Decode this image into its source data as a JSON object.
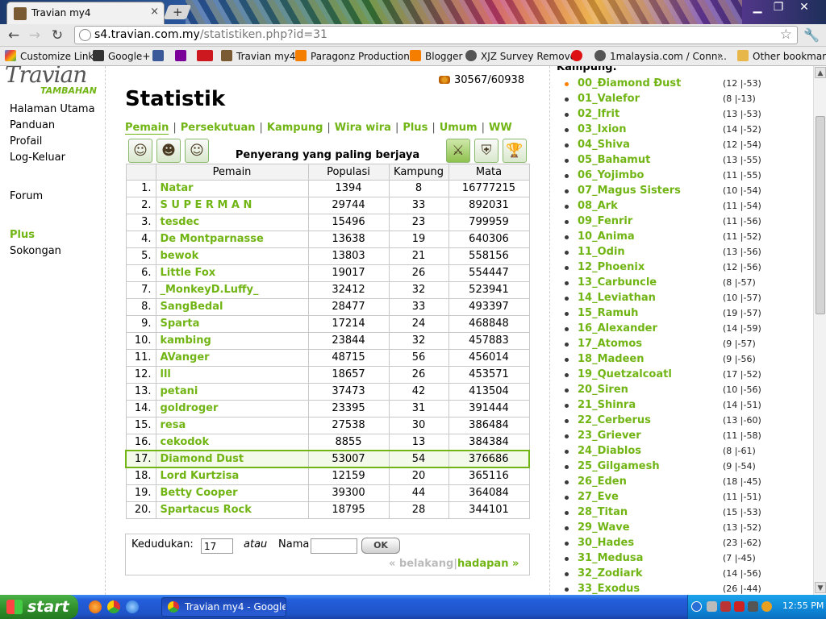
{
  "browser": {
    "tab_title": "Travian my4",
    "url_host": "s4.travian.com.my",
    "url_path": "/statistiken.php?id=31",
    "bookmarks": [
      "Customize Links",
      "Google+",
      "",
      "",
      "",
      "Travian my4",
      "Paragonz Production™",
      "Blogger",
      "XJZ Survey Remover",
      "",
      "1malaysia.com / Conn...",
      "Other bookmarks"
    ],
    "bookmarks_more": "»",
    "new_tab": "+",
    "close": "×"
  },
  "colors": {
    "accent": "#71b515",
    "active_village": "#ff8000"
  },
  "logo": {
    "main": "Travian",
    "sub": "TAMBAHAN"
  },
  "menu": [
    {
      "label": "Halaman Utama"
    },
    {
      "label": "Panduan"
    },
    {
      "label": "Profail"
    },
    {
      "label": "Log-Keluar"
    },
    {
      "label": "Forum"
    },
    {
      "label": "Plus"
    },
    {
      "label": "Sokongan"
    }
  ],
  "resources": {
    "crop": "30567/60938",
    "icon": "crop-icon"
  },
  "page_title": "Statistik",
  "stat_nav": [
    "Pemain",
    "Persekutuan",
    "Kampung",
    "Wira wira",
    "Plus",
    "Umum",
    "WW"
  ],
  "table": {
    "caption": "Penyerang yang paling berjaya",
    "headers": [
      "Pemain",
      "Populasi",
      "Kampung",
      "Mata"
    ],
    "highlight_rank": "17.",
    "rows": [
      {
        "rank": "1.",
        "name": "Natar",
        "pop": "1394",
        "vil": "8",
        "pts": "16777215"
      },
      {
        "rank": "2.",
        "name": "S U P E R M A N",
        "pop": "29744",
        "vil": "33",
        "pts": "892031"
      },
      {
        "rank": "3.",
        "name": "tesdec",
        "pop": "15496",
        "vil": "23",
        "pts": "799959"
      },
      {
        "rank": "4.",
        "name": "De Montparnasse",
        "pop": "13638",
        "vil": "19",
        "pts": "640306"
      },
      {
        "rank": "5.",
        "name": "bewok",
        "pop": "13803",
        "vil": "21",
        "pts": "558156"
      },
      {
        "rank": "6.",
        "name": "Little Fox",
        "pop": "19017",
        "vil": "26",
        "pts": "554447"
      },
      {
        "rank": "7.",
        "name": "_MonkeyD.Luffy_",
        "pop": "32412",
        "vil": "32",
        "pts": "523941"
      },
      {
        "rank": "8.",
        "name": "SangBedal",
        "pop": "28477",
        "vil": "33",
        "pts": "493397"
      },
      {
        "rank": "9.",
        "name": "Sparta",
        "pop": "17214",
        "vil": "24",
        "pts": "468848"
      },
      {
        "rank": "10.",
        "name": "kambing",
        "pop": "23844",
        "vil": "32",
        "pts": "457883"
      },
      {
        "rank": "11.",
        "name": "AVanger",
        "pop": "48715",
        "vil": "56",
        "pts": "456014"
      },
      {
        "rank": "12.",
        "name": "lll",
        "pop": "18657",
        "vil": "26",
        "pts": "453571"
      },
      {
        "rank": "13.",
        "name": "petani",
        "pop": "37473",
        "vil": "42",
        "pts": "413504"
      },
      {
        "rank": "14.",
        "name": "goldroger",
        "pop": "23395",
        "vil": "31",
        "pts": "391444"
      },
      {
        "rank": "15.",
        "name": "resa",
        "pop": "27538",
        "vil": "30",
        "pts": "386484"
      },
      {
        "rank": "16.",
        "name": "cekodok",
        "pop": "8855",
        "vil": "13",
        "pts": "384384"
      },
      {
        "rank": "17.",
        "name": "Diamond Dust",
        "pop": "53007",
        "vil": "54",
        "pts": "376686"
      },
      {
        "rank": "18.",
        "name": "Lord Kurtzisa",
        "pop": "12159",
        "vil": "20",
        "pts": "365116"
      },
      {
        "rank": "19.",
        "name": "Betty Cooper",
        "pop": "39300",
        "vil": "44",
        "pts": "364084"
      },
      {
        "rank": "20.",
        "name": "Spartacus Rock",
        "pop": "18795",
        "vil": "28",
        "pts": "344101"
      }
    ]
  },
  "search": {
    "rank_label": "Kedudukan:",
    "rank_value": "17",
    "or_label": "atau",
    "name_label": "Nama",
    "name_value": "",
    "ok_label": "OK"
  },
  "pager": {
    "prev": "« belakang",
    "sep": "|",
    "next": "hadapan »"
  },
  "villages_header": "Kampung:",
  "villages": [
    {
      "name": "00_Ðiamond Ðust",
      "coord": "(12 |-53)",
      "active": true
    },
    {
      "name": "01_Valefor",
      "coord": "(8 |-13)"
    },
    {
      "name": "02_Ifrit",
      "coord": "(13 |-53)"
    },
    {
      "name": "03_Ixion",
      "coord": "(14 |-52)"
    },
    {
      "name": "04_Shiva",
      "coord": "(12 |-54)"
    },
    {
      "name": "05_Bahamut",
      "coord": "(13 |-55)"
    },
    {
      "name": "06_Yojimbo",
      "coord": "(11 |-55)"
    },
    {
      "name": "07_Magus Sisters",
      "coord": "(10 |-54)"
    },
    {
      "name": "08_Ark",
      "coord": "(11 |-54)"
    },
    {
      "name": "09_Fenrir",
      "coord": "(11 |-56)"
    },
    {
      "name": "10_Anima",
      "coord": "(11 |-52)"
    },
    {
      "name": "11_Odin",
      "coord": "(13 |-56)"
    },
    {
      "name": "12_Phoenix",
      "coord": "(12 |-56)"
    },
    {
      "name": "13_Carbuncle",
      "coord": "(8 |-57)"
    },
    {
      "name": "14_Leviathan",
      "coord": "(10 |-57)"
    },
    {
      "name": "15_Ramuh",
      "coord": "(19 |-57)"
    },
    {
      "name": "16_Alexander",
      "coord": "(14 |-59)"
    },
    {
      "name": "17_Atomos",
      "coord": "(9 |-57)"
    },
    {
      "name": "18_Madeen",
      "coord": "(9 |-56)"
    },
    {
      "name": "19_Quetzalcoatl",
      "coord": "(17 |-52)"
    },
    {
      "name": "20_Siren",
      "coord": "(10 |-56)"
    },
    {
      "name": "21_Shinra",
      "coord": "(14 |-51)"
    },
    {
      "name": "22_Cerberus",
      "coord": "(13 |-60)"
    },
    {
      "name": "23_Griever",
      "coord": "(11 |-58)"
    },
    {
      "name": "24_Diablos",
      "coord": "(8 |-61)"
    },
    {
      "name": "25_Gilgamesh",
      "coord": "(9 |-54)"
    },
    {
      "name": "26_Eden",
      "coord": "(18 |-45)"
    },
    {
      "name": "27_Eve",
      "coord": "(11 |-51)"
    },
    {
      "name": "28_Titan",
      "coord": "(15 |-53)"
    },
    {
      "name": "29_Wave",
      "coord": "(13 |-52)"
    },
    {
      "name": "30_Hades",
      "coord": "(23 |-62)"
    },
    {
      "name": "31_Medusa",
      "coord": "(7 |-45)"
    },
    {
      "name": "32_Zodiark",
      "coord": "(14 |-56)"
    },
    {
      "name": "33_Exodus",
      "coord": "(26 |-44)"
    }
  ],
  "taskbar": {
    "start": "start",
    "app": "Travian my4 - Google...",
    "clock": "12:55 PM"
  }
}
